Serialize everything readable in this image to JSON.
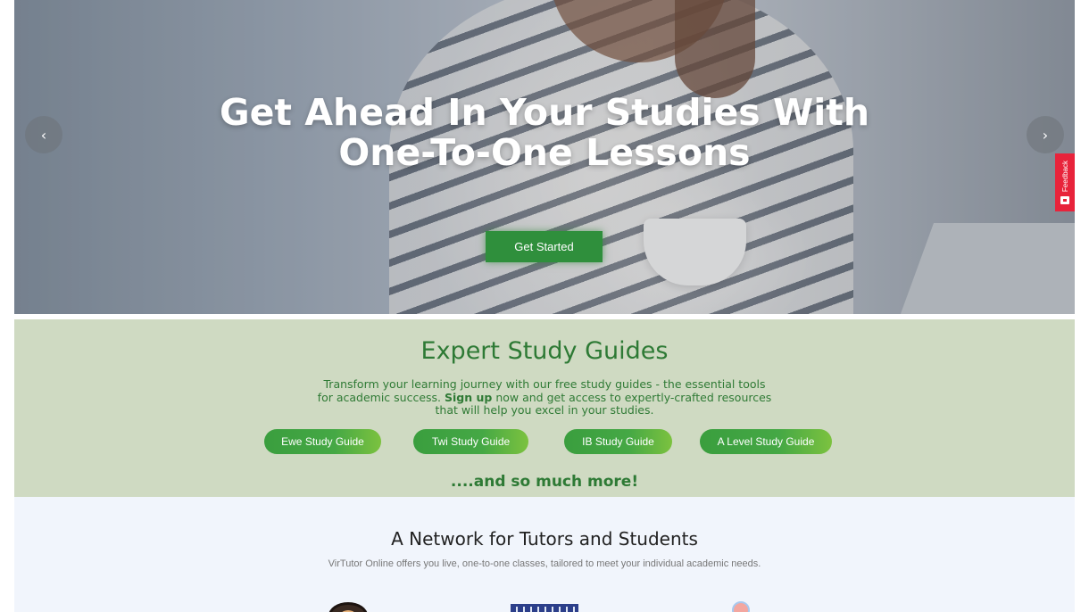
{
  "hero": {
    "title_line1": "Get Ahead In Your Studies With",
    "title_line2": "One-To-One Lessons",
    "cta_label": "Get Started",
    "prev_icon": "chevron-left-icon",
    "next_icon": "chevron-right-icon"
  },
  "feedback": {
    "label": "Feedback",
    "color": "#e8233b"
  },
  "guides": {
    "heading": "Expert Study Guides",
    "desc_before": "Transform your learning journey with our free study guides - the essential tools for academic success. ",
    "desc_bold": "Sign up",
    "desc_after": " now and get access to expertly-crafted resources that will help you excel in your studies.",
    "buttons": [
      {
        "label": "Ewe Study Guide"
      },
      {
        "label": "Twi Study Guide"
      },
      {
        "label": "IB Study Guide"
      },
      {
        "label": "A Level Study Guide"
      }
    ],
    "more": "....and so much more!",
    "accent": "#2e7a35",
    "background": "#cfdac2"
  },
  "network": {
    "heading": "A Network for Tutors and Students",
    "subtitle": "VirTutor Online offers you live, one-to-one classes, tailored to meet your individual academic needs."
  }
}
